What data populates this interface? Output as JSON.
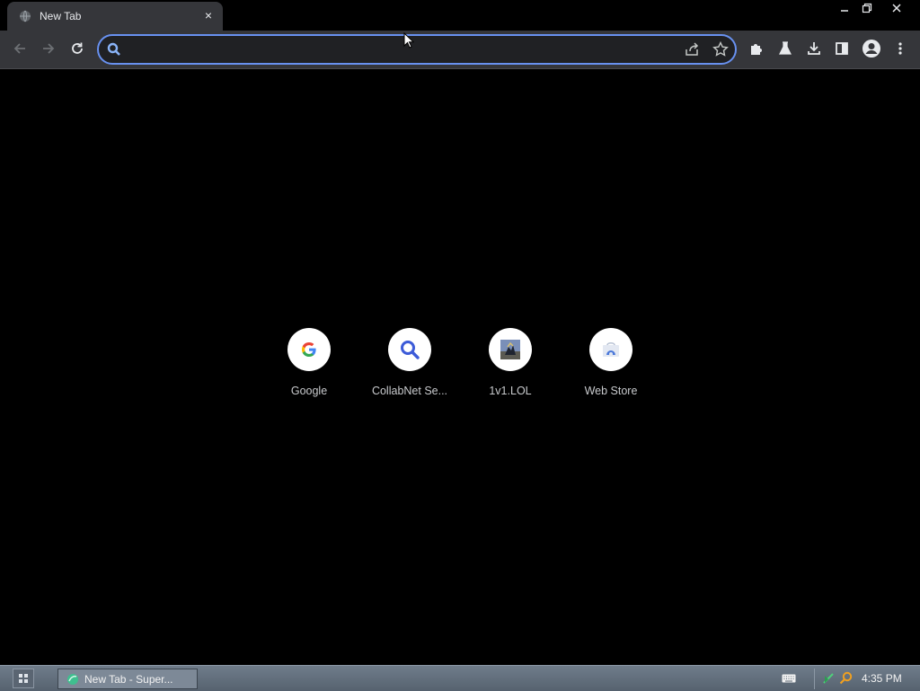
{
  "browser": {
    "tab": {
      "title": "New Tab",
      "close_glyph": "×",
      "favicon": "globe-icon"
    },
    "window_controls": [
      "minimize-icon",
      "restore-icon",
      "close-icon"
    ],
    "toolbar": {
      "back_icon": "arrow-left-icon",
      "forward_icon": "arrow-right-icon",
      "reload_icon": "reload-icon",
      "omnibox": {
        "value": "",
        "placeholder": "",
        "search_icon": "search-icon",
        "share_icon": "share-icon",
        "bookmark_icon": "star-icon"
      },
      "right_icons": [
        "puzzle-extensions-icon",
        "labs-flask-icon",
        "download-icon",
        "side-panel-icon",
        "profile-avatar-icon",
        "kebab-menu-icon"
      ]
    }
  },
  "new_tab": {
    "shortcuts": [
      {
        "label": "Google",
        "icon": "google-g-icon"
      },
      {
        "label": "CollabNet Se...",
        "icon": "magnifier-icon"
      },
      {
        "label": "1v1.LOL",
        "icon": "game-thumbnail-icon"
      },
      {
        "label": "Web Store",
        "icon": "web-store-icon"
      }
    ]
  },
  "taskbar": {
    "start_icon": "app-grid-icon",
    "task_item_label": "New Tab - Super...",
    "tray_icons": [
      "keyboard-icon",
      "network-icon",
      "search-icon"
    ],
    "clock": "4:35 PM"
  },
  "colors": {
    "background": "#000000",
    "toolbar": "#35363a",
    "omnibox_focus": "#6891f0",
    "taskbar": "#6f7c8a"
  }
}
